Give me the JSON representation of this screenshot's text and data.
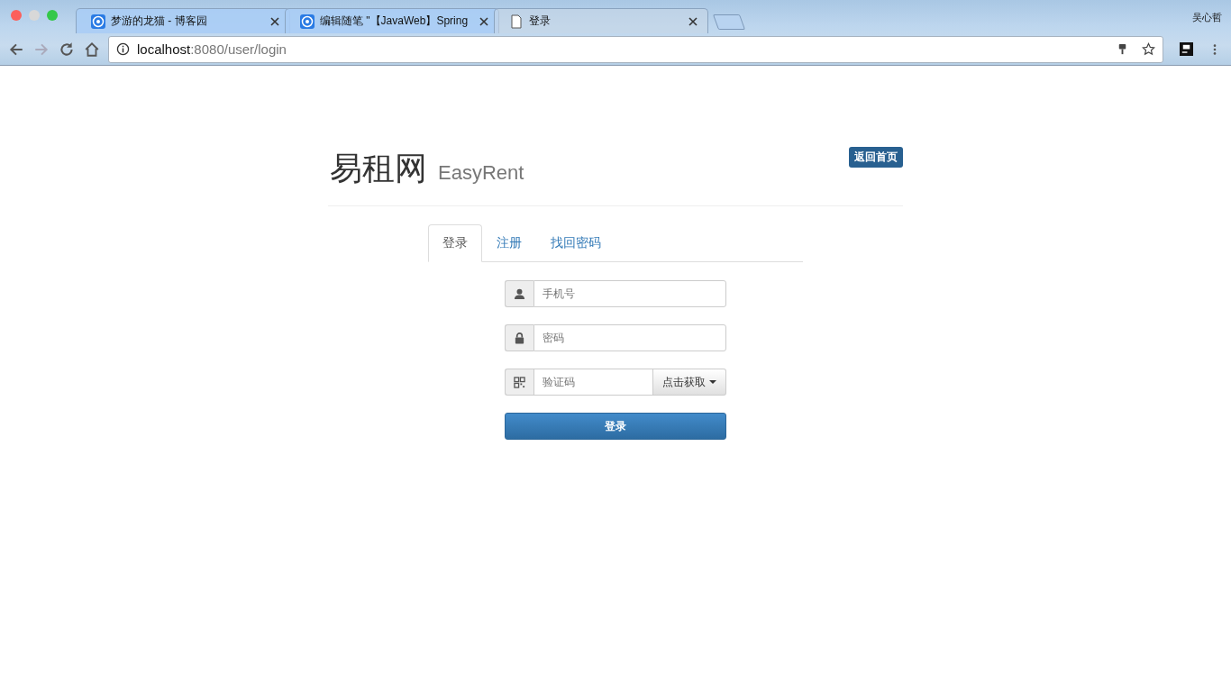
{
  "browser": {
    "tabs": [
      {
        "title": "梦游的龙猫 - 博客园",
        "kind": "site",
        "selected": false
      },
      {
        "title": "编辑随笔 \"【JavaWeb】Spring",
        "kind": "site",
        "selected": false
      },
      {
        "title": "登录",
        "kind": "page",
        "selected": true
      }
    ],
    "profile": "吴心哲",
    "url_host": "localhost",
    "url_path": ":8080/user/login"
  },
  "header": {
    "title": "易租网",
    "subtitle": "EasyRent",
    "home_button": "返回首页"
  },
  "nav_tabs": [
    {
      "label": "登录",
      "selected": true
    },
    {
      "label": "注册",
      "selected": false
    },
    {
      "label": "找回密码",
      "selected": false
    }
  ],
  "form": {
    "fields": [
      {
        "kind": "phone",
        "placeholder": "手机号"
      },
      {
        "kind": "password",
        "placeholder": "密码"
      },
      {
        "kind": "code",
        "placeholder": "验证码",
        "button": "点击获取"
      }
    ],
    "submit": "登录"
  }
}
